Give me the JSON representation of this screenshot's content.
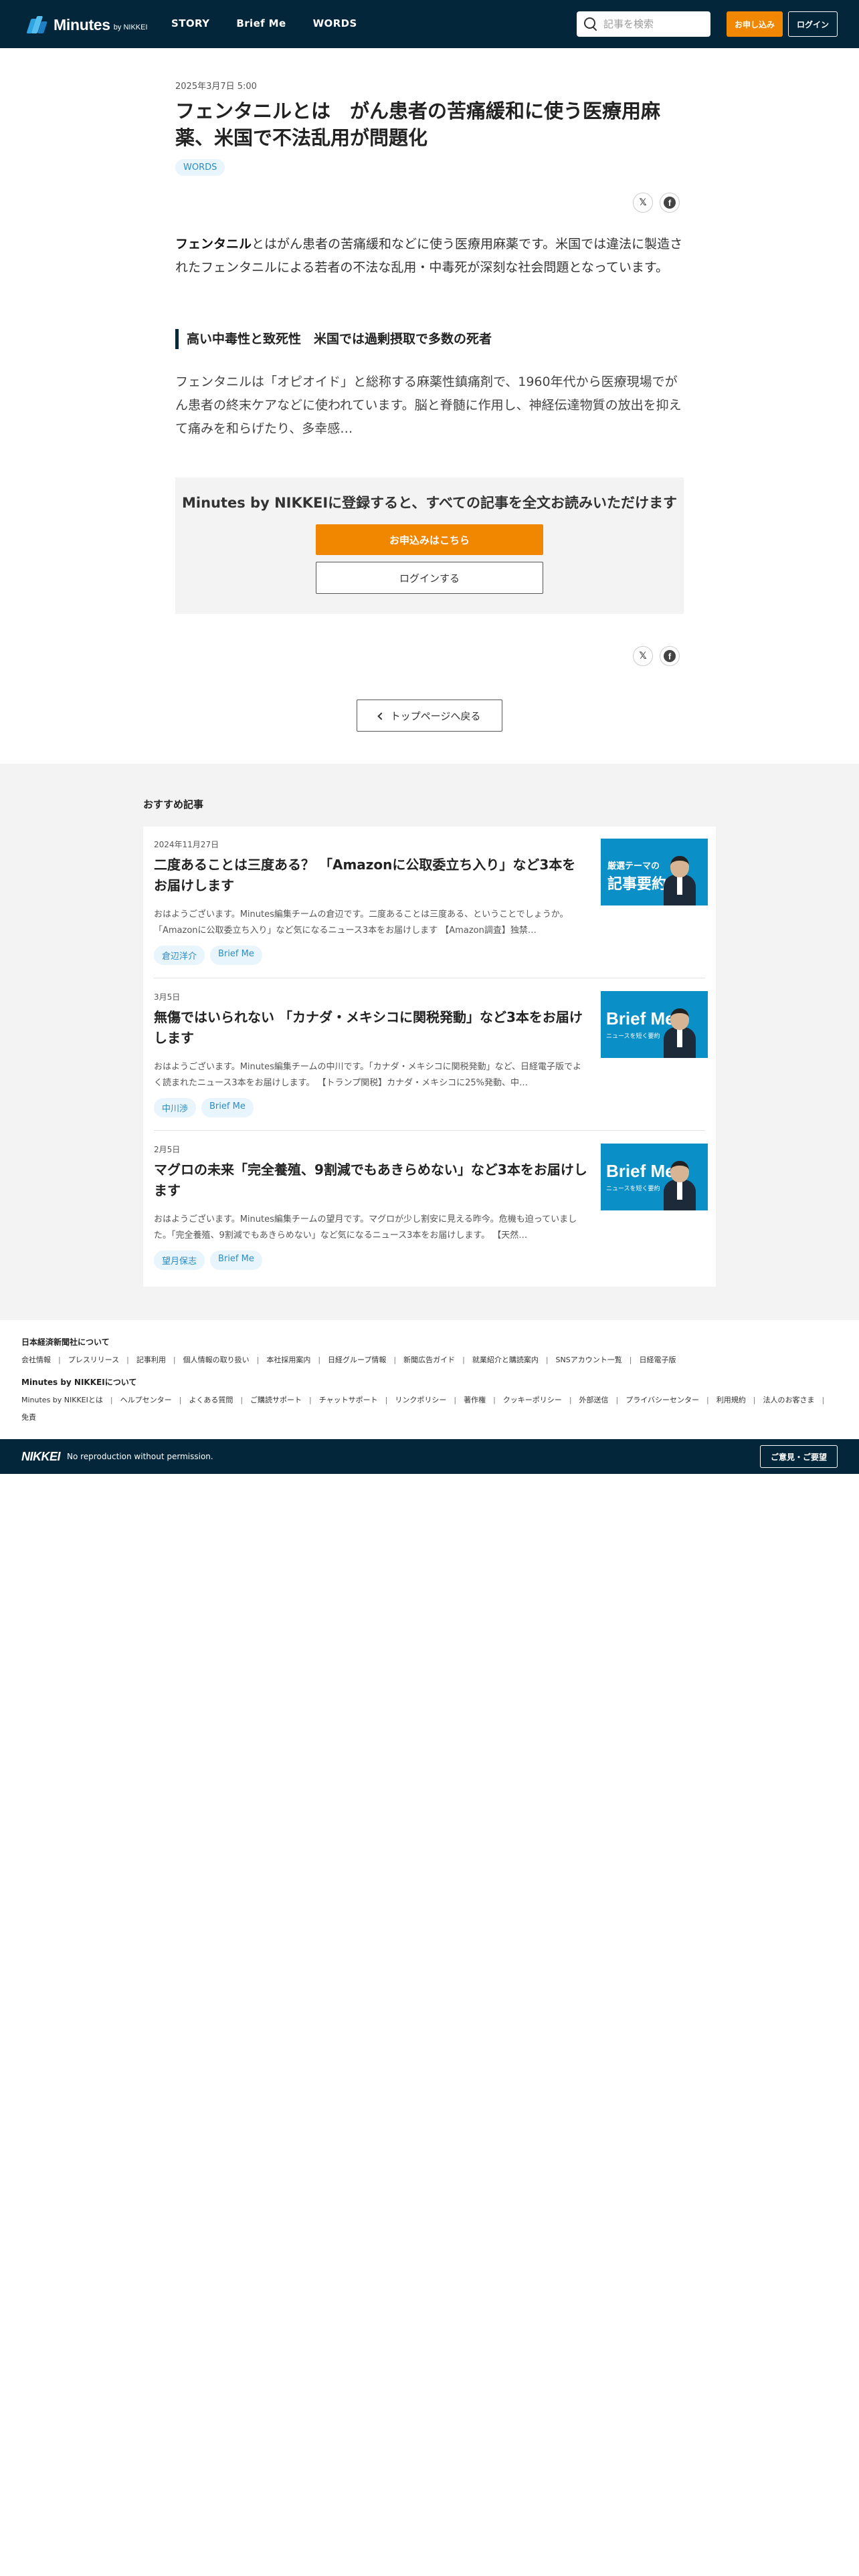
{
  "header": {
    "logo_text": "Minutes",
    "logo_by": "by NIKKEI",
    "nav": [
      "STORY",
      "Brief Me",
      "WORDS"
    ],
    "search_placeholder": "記事を検索",
    "apply_label": "お申し込み",
    "login_label": "ログイン"
  },
  "article": {
    "date": "2025年3月7日 5:00",
    "title": "フェンタニルとは　がん患者の苦痛緩和に使う医療用麻薬、米国で不法乱用が問題化",
    "tag": "WORDS",
    "lead_term": "フェンタニル",
    "lead_rest": "とはがん患者の苦痛緩和などに使う医療用麻薬です。米国では違法に製造されたフェンタニルによる若者の不法な乱用・中毒死が深刻な社会問題となっています。",
    "subheading": "高い中毒性と致死性　米国では過剰摂取で多数の死者",
    "body": "フェンタニルは「オピオイド」と総称する麻薬性鎮痛剤で、1960年代から医療現場でがん患者の終末ケアなどに使われています。脳と脊髄に作用し、神経伝達物質の放出を抑えて痛みを和らげたり、多幸感…",
    "paywall_title": "Minutes by NIKKEIに登録すると、すべての記事を全文お読みいただけます",
    "paywall_apply": "お申込みはこちら",
    "paywall_login": "ログインする",
    "back_label": "トップページへ戻る",
    "share_x": "𝕏",
    "share_fb": "f"
  },
  "recommended": {
    "heading": "おすすめ記事",
    "items": [
      {
        "date": "2024年11月27日",
        "title": "二度あることは三度ある？ 「Amazonに公取委立ち入り」など3本をお届けします",
        "excerpt": "おはようございます。Minutes編集チームの倉辺です。二度あることは三度ある、ということでしょうか。「Amazonに公取委立ち入り」など気になるニュース3本をお届けします 【Amazon調査】独禁…",
        "tags": [
          "倉辺洋介",
          "Brief Me"
        ],
        "thumb_line1": "厳選テーマの",
        "thumb_line2": "記事要約"
      },
      {
        "date": "3月5日",
        "title": "無傷ではいられない 「カナダ・メキシコに関税発動」など3本をお届けします",
        "excerpt": "おはようございます。Minutes編集チームの中川です。「カナダ・メキシコに関税発動」など、日経電子版でよく読まれたニュース3本をお届けします。 【トランプ関税】カナダ・メキシコに25%発動、中…",
        "tags": [
          "中川渉",
          "Brief Me"
        ],
        "thumb_line1": "Brief Me",
        "thumb_line2": "ニュースを短く要約"
      },
      {
        "date": "2月5日",
        "title": "マグロの未来「完全養殖、9割減でもあきらめない」など3本をお届けします",
        "excerpt": "おはようございます。Minutes編集チームの望月です。マグロが少し割安に見える昨今。危機も迫っていました。「完全養殖、9割減でもあきらめない」など気になるニュース3本をお届けします。 【天然…",
        "tags": [
          "望月保志",
          "Brief Me"
        ],
        "thumb_line1": "Brief Me",
        "thumb_line2": "ニュースを短く要約"
      }
    ]
  },
  "footer": {
    "group1_heading": "日本経済新聞社について",
    "group1_links": [
      "会社情報",
      "プレスリリース",
      "記事利用",
      "個人情報の取り扱い",
      "本社採用案内",
      "日経グループ情報",
      "新聞広告ガイド",
      "就業紹介と購読案内",
      "SNSアカウント一覧",
      "日経電子版"
    ],
    "group2_heading": "Minutes by NIKKEIについて",
    "group2_links": [
      "Minutes by NIKKEIとは",
      "ヘルプセンター",
      "よくある質問",
      "ご購読サポート",
      "チャットサポート",
      "リンクポリシー",
      "著作権",
      "クッキーポリシー",
      "外部送信",
      "プライバシーセンター",
      "利用規約",
      "法人のお客さま",
      "免責"
    ],
    "brand": "NIKKEI",
    "copyright": "No reproduction without permission.",
    "opinion_label": "ご意見・ご要望"
  },
  "colors": {
    "header_bg": "#03263b",
    "accent_orange": "#f18700",
    "tag_text": "#2b8bc2",
    "thumb_blue": "#0a8fc7"
  }
}
